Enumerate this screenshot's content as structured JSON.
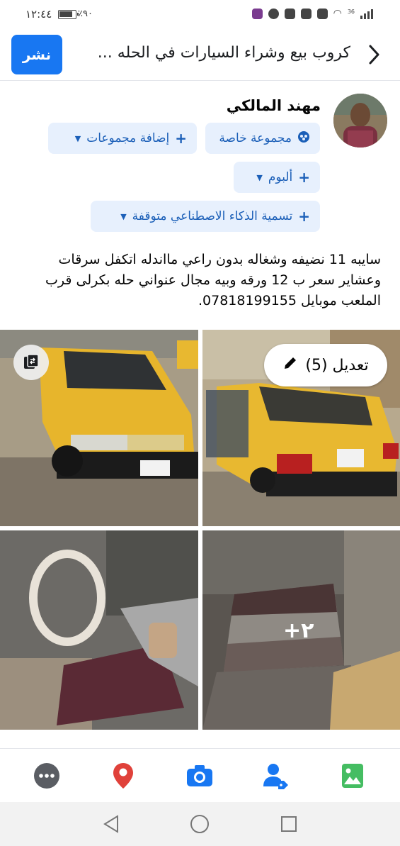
{
  "status_bar": {
    "time": "١٢:٤٤",
    "battery_percent": "٪٩٠",
    "network": "36"
  },
  "header": {
    "title": "كروب بيع وشراء  السيارات في الحله ...",
    "post_label": "نشر"
  },
  "author": {
    "name": "مهند المالكي"
  },
  "chips": {
    "private_group": "مجموعة خاصة",
    "add_groups": "إضافة مجموعات",
    "album": "ألبوم",
    "ai_label": "تسمية الذكاء الاصطناعي متوقفة"
  },
  "post": {
    "text": "سايبه 11 نضيفه وشغاله بدون راعي مااندله اتكفل سرقات وعشاير سعر ب 12 ورقه وبيه مجال عنواني حله بكرلى قرب الملعب موبايل 07818199155."
  },
  "photos": {
    "edit_label": "تعديل (5)",
    "more_count": "+٢"
  },
  "colors": {
    "accent": "#1877f2",
    "chip_bg": "#e7f0fd",
    "chip_text": "#1b5fb8",
    "location": "#e0413a",
    "photo_green": "#45bd62"
  },
  "toolbar_icons": [
    "more-icon",
    "location-pin-icon",
    "camera-icon",
    "tag-people-icon",
    "photo-icon"
  ]
}
